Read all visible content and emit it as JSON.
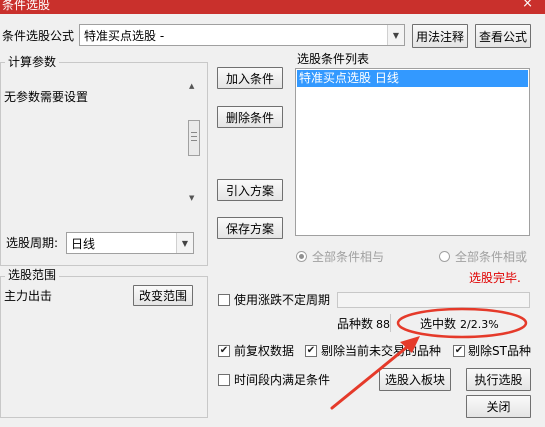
{
  "window": {
    "title": "条件选股",
    "close_glyph": "×"
  },
  "formula": {
    "label": "条件选股公式",
    "value": "特准买点选股 -",
    "usage_button": "用法注释",
    "view_button": "查看公式"
  },
  "params": {
    "group_title": "计算参数",
    "message": "无参数需要设置"
  },
  "period": {
    "label": "选股周期:",
    "value": "日线"
  },
  "buttons": {
    "add": "加入条件",
    "delete": "删除条件",
    "import": "引入方案",
    "save": "保存方案",
    "select_to_sector": "选股入板块",
    "execute": "执行选股",
    "close": "关闭",
    "change_range": "改变范围"
  },
  "condition_list": {
    "label": "选股条件列表",
    "items": [
      {
        "text": "特准买点选股  日线",
        "selected": true
      }
    ]
  },
  "logic": {
    "and_label": "全部条件相与",
    "or_label": "全部条件相或",
    "selected": "and"
  },
  "status": {
    "text": "选股完毕.",
    "color": "#e00000"
  },
  "range": {
    "group_title": "选股范围",
    "value": "主力出击"
  },
  "options": {
    "use_volatility_period": {
      "label": "使用涨跌不定周期",
      "checked": false
    },
    "adjusted_data": {
      "label": "前复权数据",
      "checked": true
    },
    "exclude_suspended": {
      "label": "剔除当前未交易的品种",
      "checked": true
    },
    "exclude_st": {
      "label": "剔除ST品种",
      "checked": true
    },
    "within_period": {
      "label": "时间段内满足条件",
      "checked": false
    }
  },
  "counts": {
    "total_label": "品种数",
    "total_value": "88",
    "selected_label": "选中数",
    "selected_value": "2/2.3%"
  },
  "annotation": {
    "color": "#e53a2a"
  },
  "icons": {
    "check": "✔",
    "dropdown": "▼",
    "scroll_up": "▲",
    "scroll_down": "▼"
  }
}
